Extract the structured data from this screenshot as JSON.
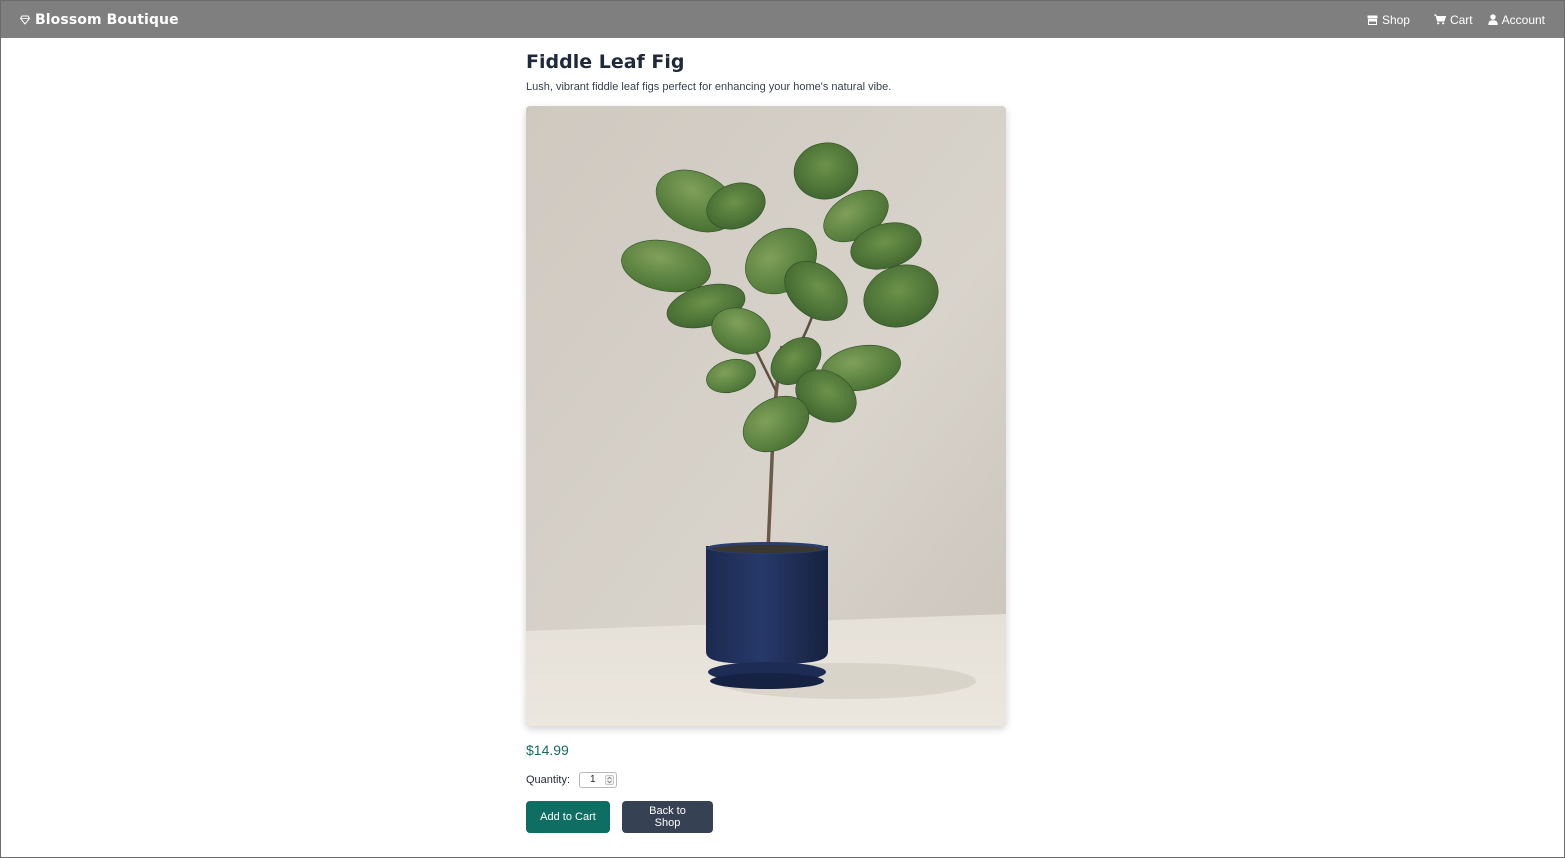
{
  "nav": {
    "brand": "Blossom Boutique",
    "brand_icon": "gem-icon",
    "links": [
      {
        "label": "Shop",
        "icon": "store-icon"
      },
      {
        "label": "Cart",
        "icon": "cart-icon"
      },
      {
        "label": "Account",
        "icon": "user-icon"
      }
    ]
  },
  "product": {
    "title": "Fiddle Leaf Fig",
    "description": "Lush, vibrant fiddle leaf figs perfect for enhancing your home's natural vibe.",
    "price": "$14.99",
    "quantity_label": "Quantity:",
    "quantity_value": "1"
  },
  "actions": {
    "add_to_cart": "Add to Cart",
    "back_to_shop": "Back to Shop"
  },
  "colors": {
    "navbar": "#7f7f7f",
    "primary": "#0f6e63",
    "secondary": "#364153",
    "price": "#176b63"
  }
}
